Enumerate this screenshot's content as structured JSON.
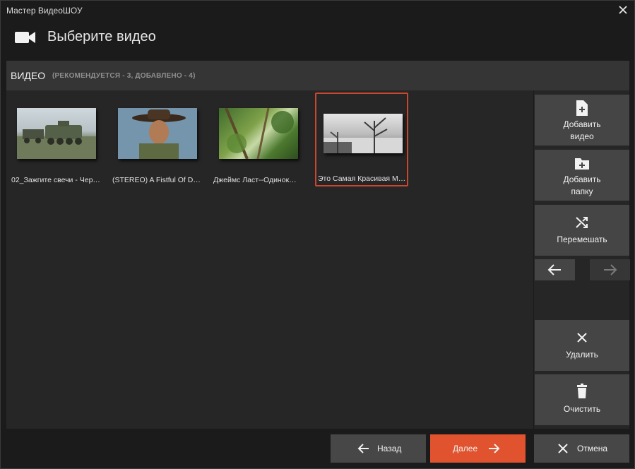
{
  "window": {
    "title": "Мастер ВидеоШОУ"
  },
  "header": {
    "title": "Выберите видео",
    "icon": "video-camera-icon"
  },
  "section": {
    "label": "ВИДЕО",
    "sub": "(РЕКОМЕНДУЕТСЯ - 3, ДОБАВЛЕНО - 4)"
  },
  "videos": [
    {
      "caption": "02_Зажгите свечи - Чер…",
      "selected": false
    },
    {
      "caption": "(STEREO) A Fistful Of D…",
      "selected": false
    },
    {
      "caption": "Джеймс Ласт--Одинок…",
      "selected": false
    },
    {
      "caption": "Это Самая Красивая М…",
      "selected": true
    }
  ],
  "sidebar": {
    "add_video": "Добавить\nвидео",
    "add_folder": "Добавить\nпапку",
    "shuffle": "Перемешать",
    "delete": "Удалить",
    "clear": "Очистить"
  },
  "footer": {
    "back": "Назад",
    "next": "Далее",
    "cancel": "Отмена"
  },
  "colors": {
    "accent": "#e0532e",
    "selected_border": "#c8472e",
    "button": "#454545",
    "panel": "#262626"
  }
}
